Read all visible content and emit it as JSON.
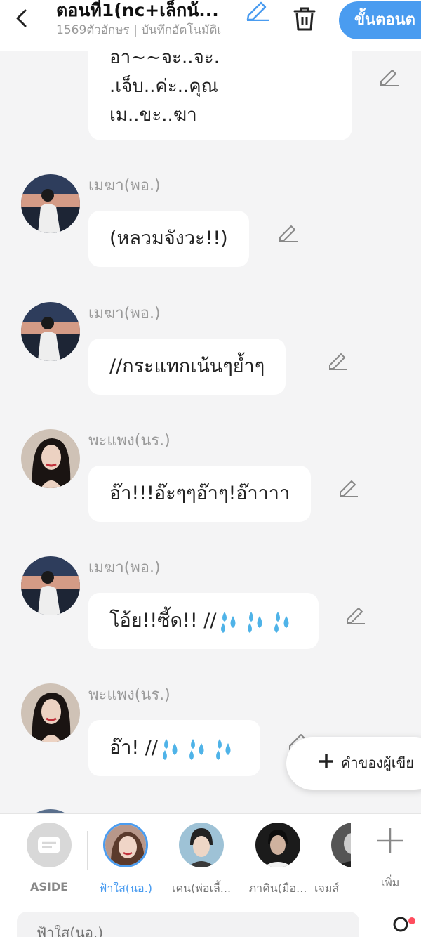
{
  "header": {
    "title": "ตอนที่1(nc+เล็กน้...",
    "subtitle": "1569ตัวอักษร | บันทึกอัตโนมัติเ",
    "next_label": "ขั้นตอนต"
  },
  "top_bubble_lines": [
    "อา~~จะ..จะ.",
    ".เจ็บ..ค่ะ..คุณ",
    "เม..ขะ..ฆา"
  ],
  "messages": [
    {
      "speaker": "เมฆา(พอ.)",
      "text": "(หลวมจังวะ!!)",
      "avatar": "male-avatar"
    },
    {
      "speaker": "เมฆา(พอ.)",
      "text": "//กระแทกเน้นๆย้ำๆ",
      "avatar": "male-avatar"
    },
    {
      "speaker": "พะแพง(นร.)",
      "text": "อ๊า!!!อ๊ะๆๆอ๊าๆ!อ๊าาาา",
      "avatar": "female-avatar"
    },
    {
      "speaker": "เมฆา(พอ.)",
      "text": "โอ้ย!!ซี้ด!! //",
      "avatar": "male-avatar",
      "emoji": "sweat-droplets"
    },
    {
      "speaker": "พะแพง(นร.)",
      "text": "อ๊า! //",
      "avatar": "female-avatar",
      "emoji": "sweat-droplets"
    }
  ],
  "fab": {
    "label": "คำของผู้เขีย"
  },
  "characters": [
    {
      "name": "ASIDE"
    },
    {
      "name": "ฟ้าใส(นอ.)",
      "selected": true
    },
    {
      "name": "เคน(พ่อเลี้..."
    },
    {
      "name": "ภาคิน(มือ..."
    },
    {
      "name": "เจมส์"
    },
    {
      "name": "เพิ่ม"
    }
  ],
  "input": {
    "placeholder": "ฟ้าใส(นอ.)"
  },
  "colors": {
    "accent": "#4a9cf0",
    "selected_name": "#4a9cf0",
    "notification": "#ff4d5e"
  }
}
